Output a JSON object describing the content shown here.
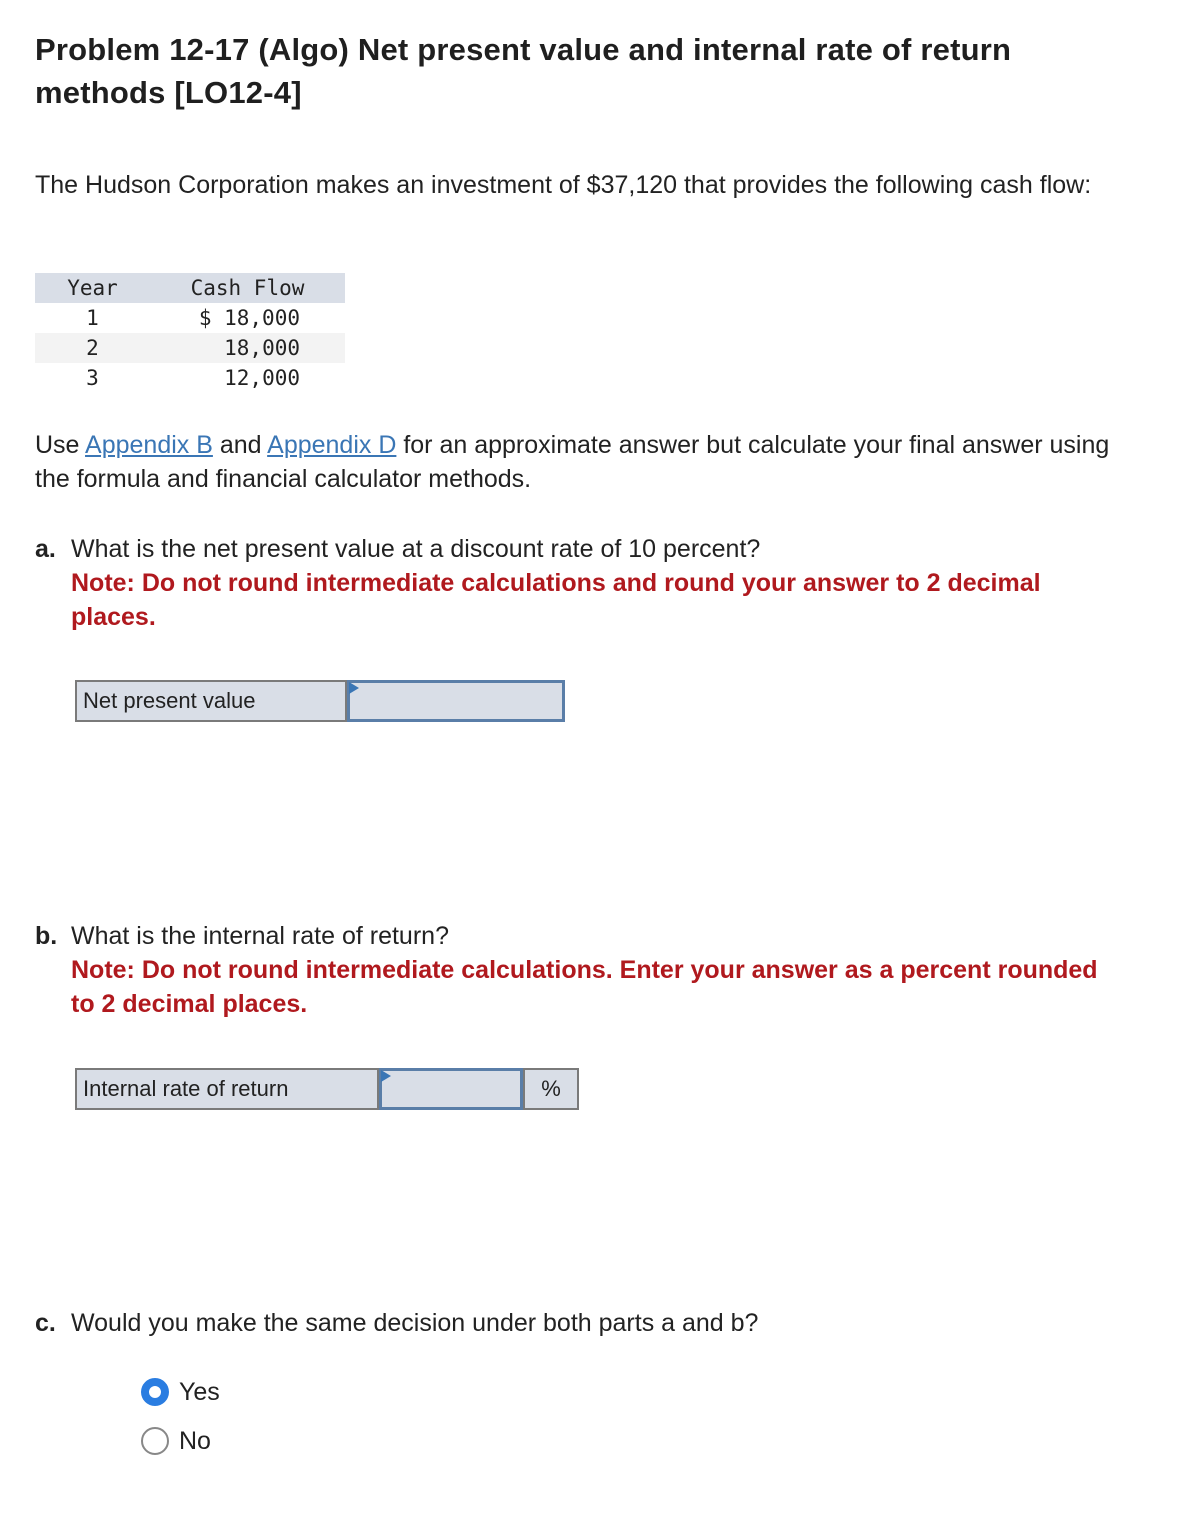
{
  "title": "Problem 12-17 (Algo) Net present value and internal rate of return methods [LO12-4]",
  "intro": "The Hudson Corporation makes an investment of $37,120 that provides the following cash flow:",
  "cash_flow_table": {
    "headers": [
      "Year",
      "Cash Flow"
    ],
    "rows": [
      {
        "year": "1",
        "cash_flow": "$ 18,000"
      },
      {
        "year": "2",
        "cash_flow": "18,000"
      },
      {
        "year": "3",
        "cash_flow": "12,000"
      }
    ]
  },
  "instructions": {
    "prefix": "Use ",
    "link1": "Appendix B",
    "middle": " and ",
    "link2": "Appendix D",
    "suffix": " for an approximate answer but calculate your final answer using the formula and financial calculator methods."
  },
  "part_a": {
    "label": "a.",
    "question": "What is the net present value at a discount rate of 10 percent?",
    "note": "Note: Do not round intermediate calculations and round your answer to 2 decimal places.",
    "field_label": "Net present value",
    "field_value": ""
  },
  "part_b": {
    "label": "b.",
    "question": "What is the internal rate of return?",
    "note": "Note: Do not round intermediate calculations. Enter your answer as a percent rounded to 2 decimal places.",
    "field_label": "Internal rate of return",
    "field_value": "",
    "unit": "%"
  },
  "part_c": {
    "label": "c.",
    "question": "Would you make the same decision under both parts a and b?",
    "options": [
      {
        "label": "Yes",
        "selected": true
      },
      {
        "label": "No",
        "selected": false
      }
    ]
  },
  "colors": {
    "note_red": "#b0191e",
    "link_blue": "#3a76b5",
    "radio_selected": "#2a7de1",
    "field_bg": "#d9dee7"
  }
}
